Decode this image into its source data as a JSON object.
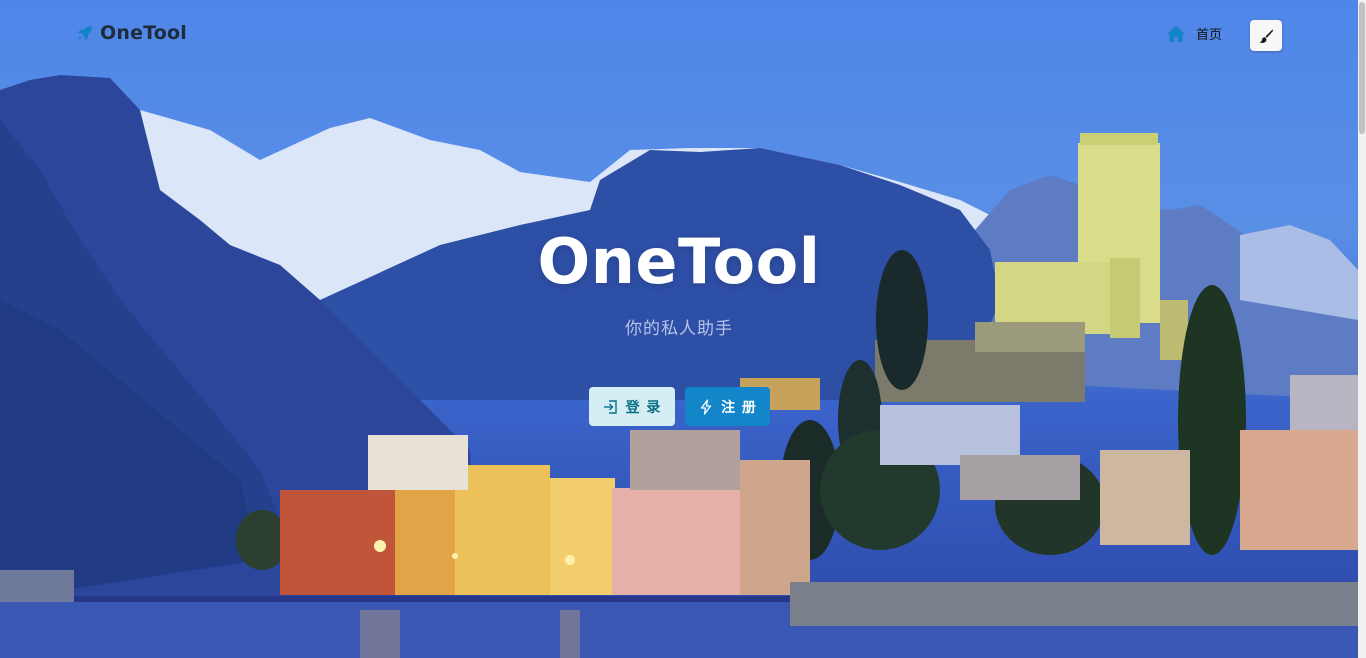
{
  "nav": {
    "brand": "OneTool",
    "home_label": "首页",
    "theme_toggle_icon": "paintbrush-icon"
  },
  "hero": {
    "title": "OneTool",
    "subtitle": "你的私人助手",
    "login_label": "登 录",
    "register_label": "注 册"
  },
  "colors": {
    "accent_blue": "#1386c9",
    "login_bg": "#d4eef4",
    "brand_icon": "#1384c8"
  }
}
